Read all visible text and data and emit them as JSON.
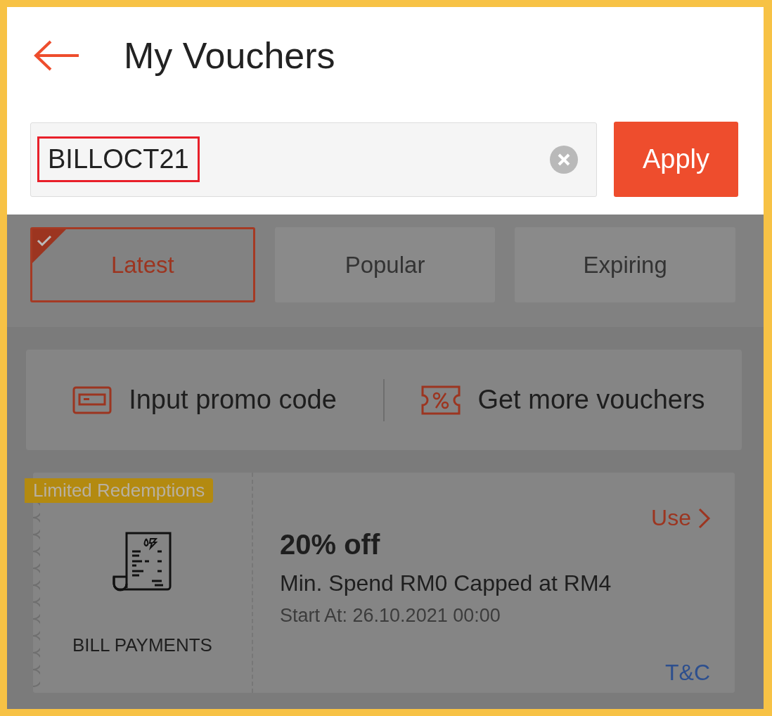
{
  "header": {
    "title": "My Vouchers"
  },
  "code_field": {
    "value": "BILLOCT21",
    "highlighted": true,
    "button": "Apply"
  },
  "tabs": [
    {
      "label": "Latest",
      "selected": true
    },
    {
      "label": "Popular",
      "selected": false
    },
    {
      "label": "Expiring",
      "selected": false
    }
  ],
  "actions": [
    {
      "kind": "code",
      "label": "Input promo code"
    },
    {
      "kind": "ticket",
      "label": "Get more vouchers"
    }
  ],
  "vouchers": [
    {
      "badge": "Limited Redemptions",
      "category": "BILL PAYMENTS",
      "title": "20% off",
      "condition": "Min. Spend RM0 Capped at RM4",
      "start": "Start At: 26.10.2021 00:00",
      "use": "Use",
      "terms": "T&C"
    }
  ]
}
